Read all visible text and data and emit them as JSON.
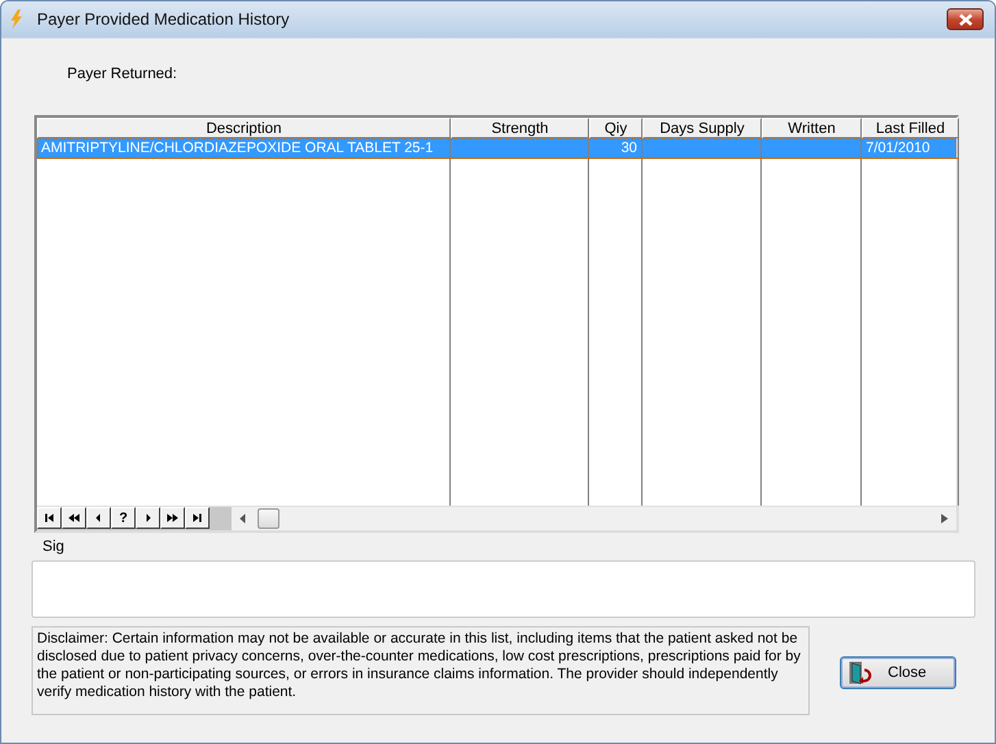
{
  "window": {
    "title": "Payer Provided Medication History"
  },
  "payer_returned_label": "Payer Returned:",
  "table": {
    "columns": [
      {
        "label": "Description",
        "kind": "text"
      },
      {
        "label": "Strength",
        "kind": "text"
      },
      {
        "label": "Qiy",
        "kind": "number"
      },
      {
        "label": "Days Supply",
        "kind": "text"
      },
      {
        "label": "Written",
        "kind": "text"
      },
      {
        "label": "Last Filled",
        "kind": "text"
      }
    ],
    "rows": [
      {
        "selected": true,
        "cells": [
          "AMITRIPTYLINE/CHLORDIAZEPOXIDE ORAL TABLET 25-1",
          "",
          "30",
          "",
          "",
          "7/01/2010"
        ]
      }
    ]
  },
  "navigator": [
    {
      "kind": "first"
    },
    {
      "kind": "prev-page"
    },
    {
      "kind": "prev"
    },
    {
      "kind": "help",
      "label": "?"
    },
    {
      "kind": "next"
    },
    {
      "kind": "next-page"
    },
    {
      "kind": "last"
    }
  ],
  "sig": {
    "label": "Sig"
  },
  "disclaimer": "Disclaimer: Certain information may not be available or accurate in this list, including items that the patient asked not be disclosed due to patient privacy concerns, over-the-counter medications, low cost prescriptions, prescriptions paid for by the patient or non-participating sources, or errors in insurance claims information.  The provider should independently verify medication history with the patient.",
  "buttons": [
    {
      "label": "Close"
    }
  ]
}
